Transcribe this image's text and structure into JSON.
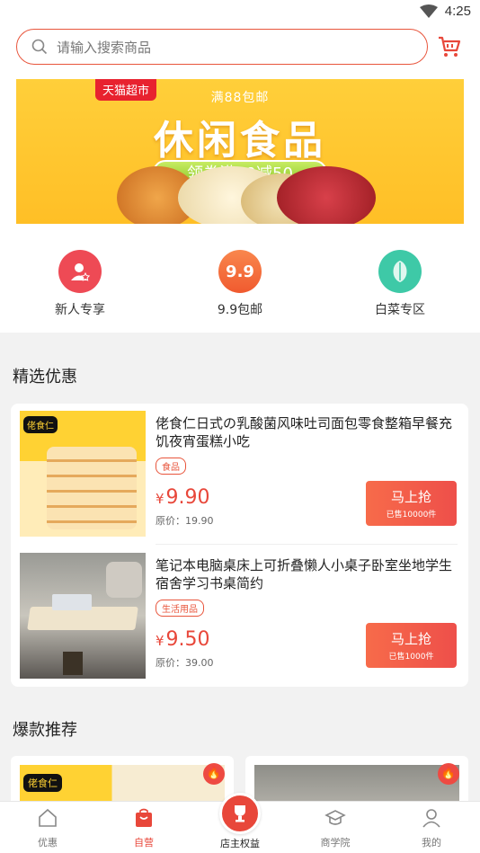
{
  "status": {
    "time": "4:25"
  },
  "search": {
    "placeholder": "请输入搜索商品"
  },
  "banner": {
    "tag": "天猫超市",
    "free_ship": "满88包邮",
    "headline": "休闲食品",
    "coupon": "领券满99减50"
  },
  "quick_links": [
    {
      "label": "新人专享",
      "icon": "user-star-icon",
      "color": "#ee4a55"
    },
    {
      "label": "9.9包邮",
      "icon": "9-9-icon",
      "color": "#f46b3c",
      "badge": "9.9"
    },
    {
      "label": "白菜专区",
      "icon": "cabbage-icon",
      "color": "#3ec9a7"
    }
  ],
  "deals_section": {
    "title": "精选优惠"
  },
  "deals": [
    {
      "name": "佬食仁日式の乳酸菌风味吐司面包零食整箱早餐充饥夜宵蛋糕小吃",
      "category": "食品",
      "yen": "¥",
      "price": "9.90",
      "original": "原价：19.90",
      "buy_label": "马上抢",
      "sold": "已售10000件"
    },
    {
      "name": "笔记本电脑桌床上可折叠懒人小桌子卧室坐地学生宿舍学习书桌简约",
      "category": "生活用品",
      "yen": "¥",
      "price": "9.50",
      "original": "原价：39.00",
      "buy_label": "马上抢",
      "sold": "已售1000件"
    }
  ],
  "hot_section": {
    "title": "爆款推荐"
  },
  "tabbar": {
    "tabs": [
      "优惠",
      "自营",
      "店主权益",
      "商学院",
      "我的"
    ],
    "active": "自营"
  },
  "colors": {
    "accent": "#e8473a",
    "search_border": "#e8553c"
  }
}
